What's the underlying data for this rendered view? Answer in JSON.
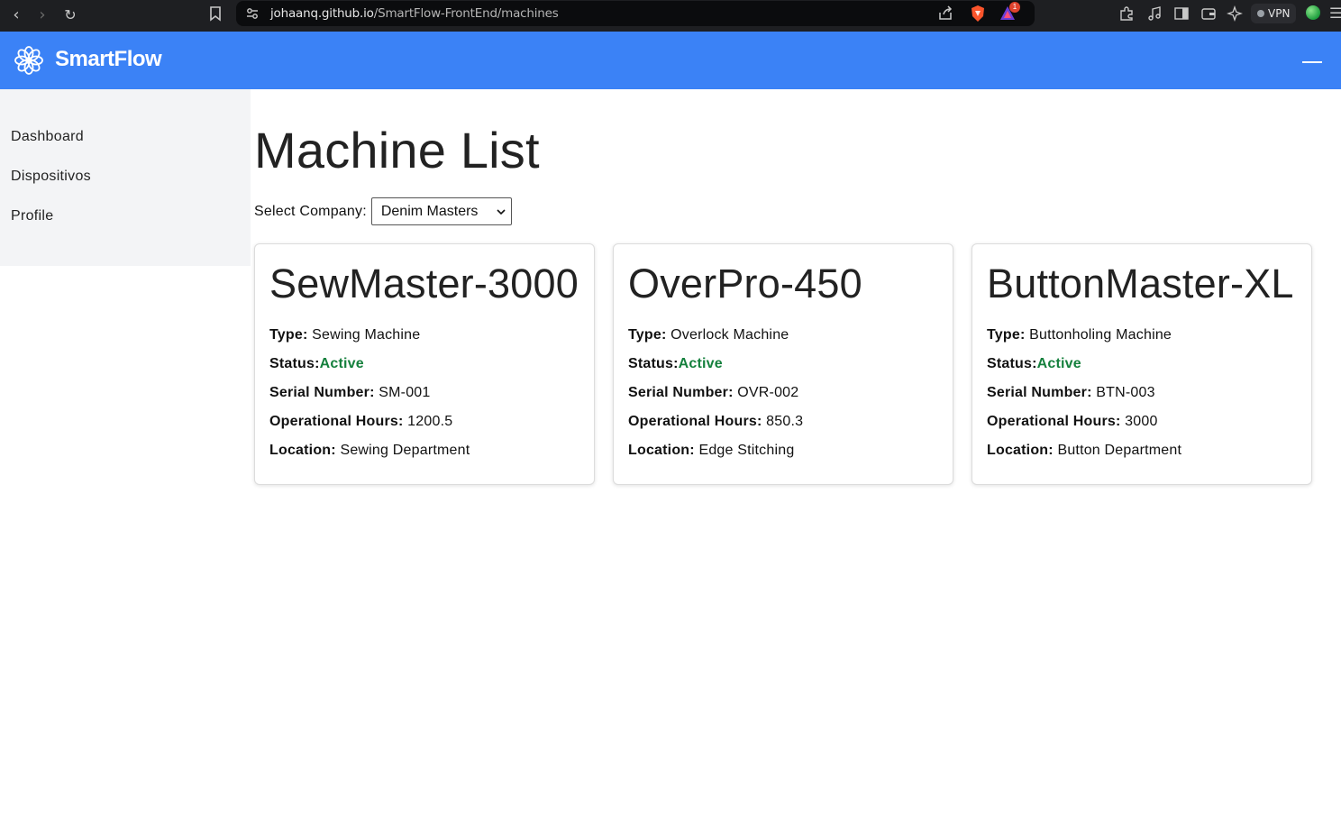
{
  "browser": {
    "url_host": "johaanq.github.io",
    "url_path": "/SmartFlow-FrontEnd/machines",
    "rewards_badge": "1",
    "vpn_label": "VPN"
  },
  "header": {
    "brand": "SmartFlow"
  },
  "sidebar": {
    "items": [
      {
        "label": "Dashboard"
      },
      {
        "label": "Dispositivos"
      },
      {
        "label": "Profile"
      }
    ]
  },
  "main": {
    "title": "Machine List",
    "company_label": "Select Company:",
    "company_selected": "Denim Masters"
  },
  "labels": {
    "type": "Type:",
    "status": "Status:",
    "serial": "Serial Number:",
    "hours": "Operational Hours:",
    "location": "Location:"
  },
  "machines": [
    {
      "name": "SewMaster-3000",
      "type": "Sewing Machine",
      "status": "Active",
      "serial": "SM-001",
      "hours": "1200.5",
      "location": "Sewing Department"
    },
    {
      "name": "OverPro-450",
      "type": "Overlock Machine",
      "status": "Active",
      "serial": "OVR-002",
      "hours": "850.3",
      "location": "Edge Stitching"
    },
    {
      "name": "ButtonMaster-XL",
      "type": "Buttonholing Machine",
      "status": "Active",
      "serial": "BTN-003",
      "hours": "3000",
      "location": "Button Department"
    }
  ],
  "colors": {
    "header_bg": "#3b82f6",
    "sidebar_bg": "#f3f4f6",
    "status_active": "#15803d"
  }
}
